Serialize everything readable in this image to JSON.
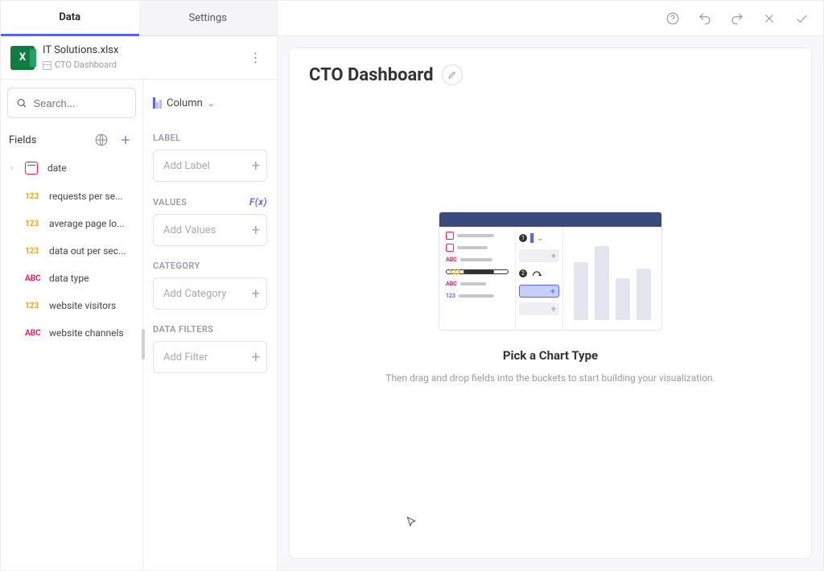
{
  "tabs": {
    "data": "Data",
    "settings": "Settings"
  },
  "file": {
    "name": "IT Solutions.xlsx",
    "sheet": "CTO Dashboard"
  },
  "search": {
    "placeholder": "Search..."
  },
  "fieldsHeader": "Fields",
  "fields": [
    {
      "type": "date",
      "label": "date"
    },
    {
      "type": "123",
      "label": "requests per se..."
    },
    {
      "type": "123",
      "label": "average page lo..."
    },
    {
      "type": "123",
      "label": "data out per sec..."
    },
    {
      "type": "ABC",
      "label": "data type"
    },
    {
      "type": "123",
      "label": "website visitors"
    },
    {
      "type": "ABC",
      "label": "website channels"
    }
  ],
  "chartPicker": "Column",
  "sections": {
    "label": {
      "title": "LABEL",
      "placeholder": "Add Label"
    },
    "values": {
      "title": "VALUES",
      "placeholder": "Add Values",
      "fx": "F(x)"
    },
    "category": {
      "title": "CATEGORY",
      "placeholder": "Add Category"
    },
    "filters": {
      "title": "DATA FILTERS",
      "placeholder": "Add Filter"
    }
  },
  "canvas": {
    "title": "CTO Dashboard",
    "placeholder_title": "Pick a Chart Type",
    "placeholder_sub": "Then drag and drop fields into the buckets to start building your visualization."
  }
}
